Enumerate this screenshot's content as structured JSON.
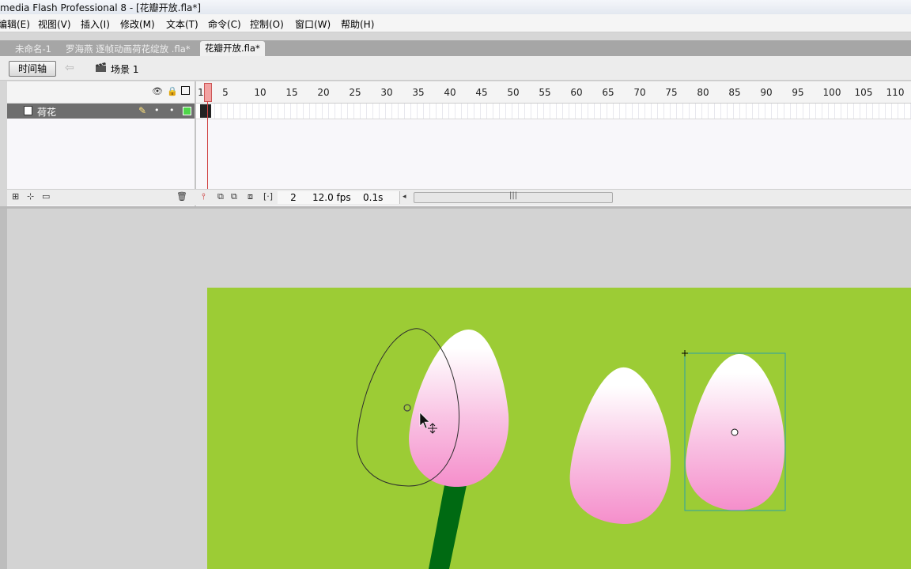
{
  "window": {
    "title": "media Flash Professional 8 - [花瓣开放.fla*]"
  },
  "menu": [
    "编辑(E)",
    "视图(V)",
    "插入(I)",
    "修改(M)",
    "文本(T)",
    "命令(C)",
    "控制(O)",
    "窗口(W)",
    "帮助(H)"
  ],
  "doc_tabs": [
    "未命名-1",
    "罗海燕 逐帧动画荷花绽放 .fla*",
    "花瓣开放.fla*"
  ],
  "toolbar": {
    "timeline_button": "时间轴",
    "scene_label": "场景 1"
  },
  "layers": [
    {
      "name": "荷花"
    }
  ],
  "ruler": {
    "labels": [
      "1",
      "5",
      "10",
      "15",
      "20",
      "25",
      "30",
      "35",
      "40",
      "45",
      "50",
      "55",
      "60",
      "65",
      "70",
      "75",
      "80",
      "85",
      "90",
      "95",
      "100",
      "105",
      "110"
    ]
  },
  "timeline_status": {
    "current_frame": "2",
    "frame_rate": "12.0 fps",
    "elapsed": "0.1s"
  },
  "colors": {
    "stage": "#9ccc35",
    "petal_pink": "#f58ecb",
    "stem": "#006a12",
    "selection": "#2aa0a8"
  }
}
